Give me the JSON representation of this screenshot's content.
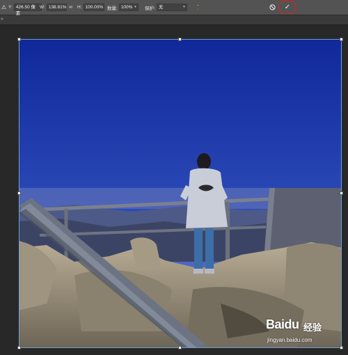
{
  "options_bar": {
    "reference_icon": "reference-point-icon",
    "y_label": "Y:",
    "y_value": "426.50 像素",
    "w_label": "W:",
    "w_value": "138.81%",
    "link_icon": "link-icon",
    "h_label": "H:",
    "h_value": "100.00%",
    "opacity_label": "数量:",
    "opacity_value": "100%",
    "interp_label": "保护:",
    "interp_value": "无",
    "person_icon": "person-icon",
    "cancel_icon": "cancel-icon",
    "commit_icon": "checkmark-icon",
    "commit_symbol": "✓",
    "cancel_symbol": "⊘",
    "highlight_color": "#e02020"
  },
  "tabstrip": {
    "chevron": "»"
  },
  "watermark": {
    "logo": "Baiдu",
    "logo_text": "Baidu",
    "suffix": "经验",
    "url": "jingyan.baidu.com"
  }
}
